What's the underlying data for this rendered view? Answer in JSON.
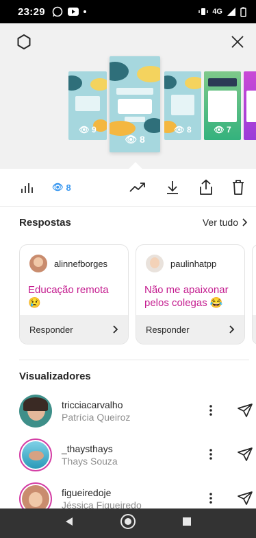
{
  "status_bar": {
    "time": "23:29",
    "network": "4G"
  },
  "thumbnails": [
    {
      "views": "9"
    },
    {
      "views": "8"
    },
    {
      "views": "8"
    },
    {
      "views": "7"
    },
    {
      "views": ""
    }
  ],
  "toolbar": {
    "views_count": "8"
  },
  "responses": {
    "title": "Respostas",
    "see_all": "Ver tudo",
    "cards": [
      {
        "username": "alinnefborges",
        "answer": "Educação remota 😢",
        "reply_label": "Responder"
      },
      {
        "username": "paulinhatpp",
        "answer": "Não me apaixonar pelos colegas 😂",
        "reply_label": "Responder"
      }
    ]
  },
  "viewers": {
    "title": "Visualizadores",
    "list": [
      {
        "username": "tricciacarvalho",
        "name": "Patrícia Queiroz"
      },
      {
        "username": "_thaysthays",
        "name": "Thays Souza"
      },
      {
        "username": "figueiredoje",
        "name": "Jéssica Figueiredo"
      }
    ]
  },
  "colors": {
    "accent": "#3897f0",
    "answer_text": "#c41c8f",
    "story_ring": "#d43fa5"
  }
}
